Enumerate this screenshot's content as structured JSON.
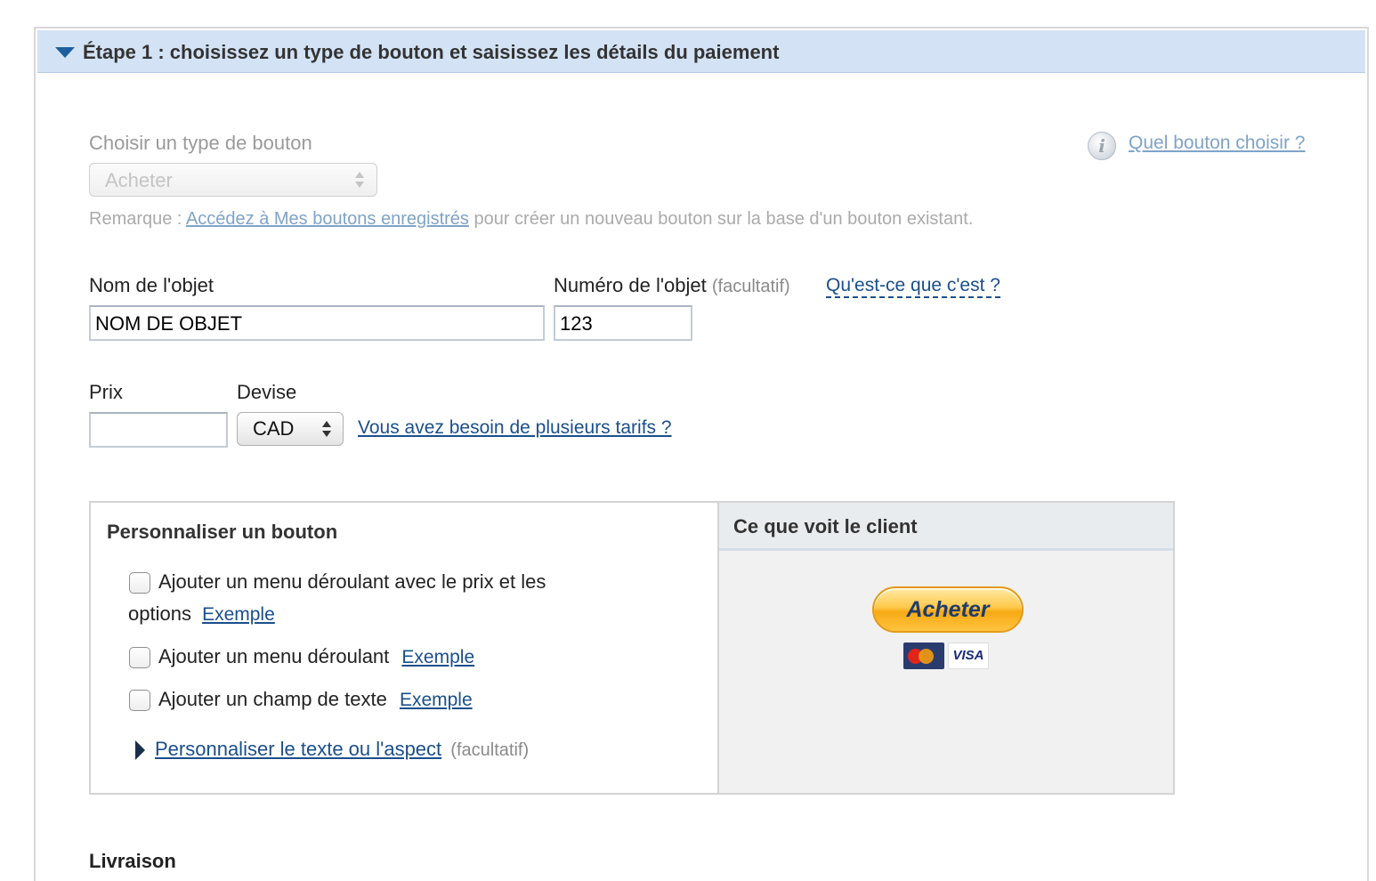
{
  "step": {
    "title": "Étape 1 : choisissez un type de bouton et saisissez les détails du paiement"
  },
  "button_type": {
    "label": "Choisir un type de bouton",
    "selected": "Acheter",
    "help_link": "Quel bouton choisir ?"
  },
  "remark": {
    "prefix": "Remarque : ",
    "link": "Accédez à Mes boutons enregistrés",
    "suffix": " pour créer un nouveau bouton sur la base d'un bouton existant."
  },
  "item": {
    "name_label": "Nom de l'objet",
    "name_value": "NOM DE OBJET",
    "number_label": "Numéro de l'objet",
    "number_optional": "(facultatif)",
    "number_help": "Qu'est-ce que c'est ?",
    "number_value": "123"
  },
  "price": {
    "label": "Prix",
    "value": "",
    "currency_label": "Devise",
    "currency_value": "CAD",
    "multi_link": "Vous avez besoin de plusieurs tarifs ?"
  },
  "customize": {
    "title": "Personnaliser un bouton",
    "options": [
      {
        "line1": "Ajouter un menu déroulant avec le prix et les",
        "line2": "options",
        "example": "Exemple",
        "checked": false
      },
      {
        "line1": "Ajouter un menu déroulant",
        "example": "Exemple",
        "checked": false
      },
      {
        "line1": "Ajouter un champ de texte",
        "example": "Exemple",
        "checked": false
      }
    ],
    "appearance_link": "Personnaliser le texte ou l'aspect",
    "appearance_optional": "(facultatif)"
  },
  "preview": {
    "title": "Ce que voit le client",
    "button_label": "Acheter",
    "cards": [
      "mastercard-icon",
      "visa-icon"
    ],
    "visa_text": "VISA"
  },
  "shipping": {
    "title": "Livraison"
  },
  "colors": {
    "header_bg": "#d3e3f5",
    "link": "#1a4f8b",
    "button_orange": "#ffc94a"
  }
}
